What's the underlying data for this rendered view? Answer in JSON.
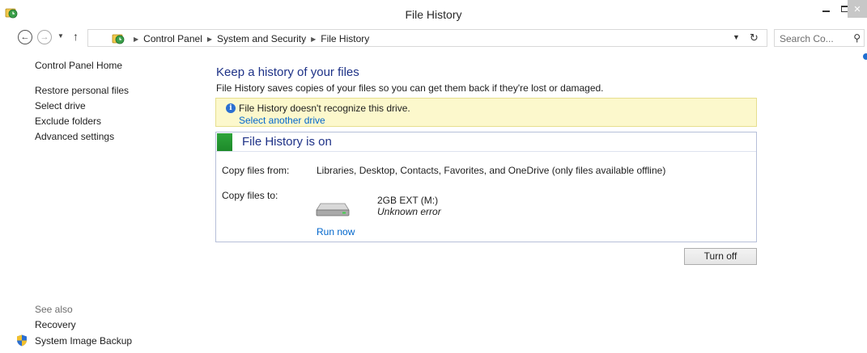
{
  "window": {
    "title": "File History",
    "close_glyph": "✕"
  },
  "address": {
    "crumbs": [
      "Control Panel",
      "System and Security",
      "File History"
    ],
    "search_placeholder": "Search Co..."
  },
  "left_nav": {
    "items": [
      "Control Panel Home",
      "Restore personal files",
      "Select drive",
      "Exclude folders",
      "Advanced settings"
    ],
    "see_also_label": "See also",
    "see_also_items": [
      "Recovery",
      "System Image Backup"
    ]
  },
  "main": {
    "title": "Keep a history of your files",
    "description": "File History saves copies of your files so you can get them back if they're lost or damaged.",
    "warning": {
      "text": "File History doesn't recognize this drive.",
      "link": "Select another drive"
    },
    "status": {
      "title": "File History is on",
      "copy_from_label": "Copy files from:",
      "copy_from_value": "Libraries, Desktop, Contacts, Favorites, and OneDrive (only files available offline)",
      "copy_to_label": "Copy files to:",
      "drive_name": "2GB EXT (M:)",
      "drive_status": "Unknown error",
      "run_now": "Run now"
    },
    "turn_off_label": "Turn off"
  },
  "icons": {
    "app": "file-history-icon",
    "back": "back-arrow-icon",
    "forward": "forward-arrow-icon",
    "up": "up-arrow-icon",
    "refresh": "refresh-icon",
    "search": "search-icon",
    "info": "info-icon",
    "drive": "hard-drive-icon",
    "shield": "uac-shield-icon"
  },
  "colors": {
    "accent_heading": "#1e3287",
    "link": "#0066cc",
    "warning_bg": "#fcf8cc",
    "status_on": "#2ea43a"
  }
}
